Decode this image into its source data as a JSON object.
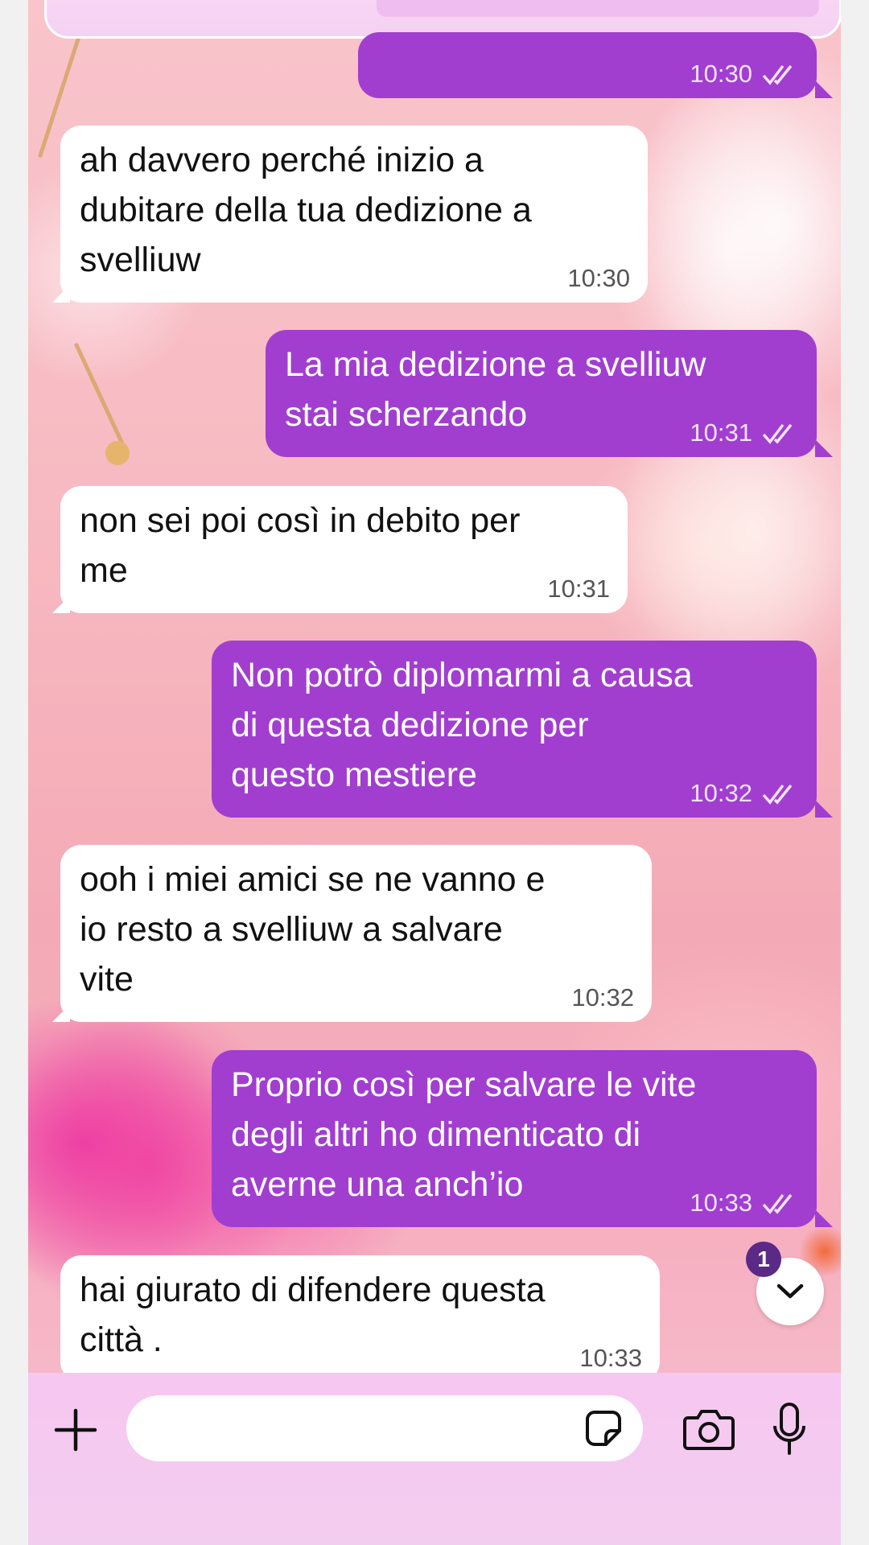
{
  "colors": {
    "incoming_bubble": "#ffffff",
    "outgoing_bubble": "#a13ed0",
    "unread_badge": "#5b2a86",
    "composer_bg": "#f6c7f1"
  },
  "top_message": {
    "time": "10:30"
  },
  "messages": [
    {
      "direction": "incoming",
      "text": "ah davvero perché inizio a\ndubitare della tua dedizione a\nsvelliuw",
      "time": "10:30"
    },
    {
      "direction": "outgoing",
      "text": "La mia dedizione a svelliuw\nstai scherzando",
      "time": "10:31"
    },
    {
      "direction": "incoming",
      "text": "non sei poi così in debito per\nme",
      "time": "10:31"
    },
    {
      "direction": "outgoing",
      "text": "Non potrò diplomarmi a causa\ndi questa dedizione per\nquesto mestiere",
      "time": "10:32"
    },
    {
      "direction": "incoming",
      "text": "ooh i miei amici se ne vanno e\nio resto a svelliuw a salvare\nvite",
      "time": "10:32"
    },
    {
      "direction": "outgoing",
      "text": "Proprio così per salvare le vite\ndegli altri ho dimenticato di\naverne una anch’io",
      "time": "10:33"
    },
    {
      "direction": "incoming",
      "text": "hai giurato di difendere questa\ncittà .",
      "time": "10:33"
    }
  ],
  "scroll_to_bottom": {
    "unread_count": "1",
    "icon": "chevron-down-icon"
  },
  "composer": {
    "input_value": "",
    "icons": [
      "plus-icon",
      "sticker-icon",
      "camera-icon",
      "microphone-icon"
    ]
  }
}
